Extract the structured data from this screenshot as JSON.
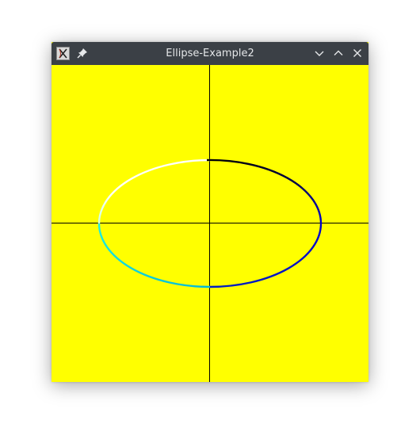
{
  "window": {
    "title": "Ellipse-Example2"
  },
  "icons": {
    "app": "app-icon",
    "pin": "pin-icon",
    "minimize": "chevron-down-icon",
    "maximize": "chevron-up-icon",
    "close": "close-icon"
  },
  "colors": {
    "background": "#ffff00",
    "axes": "#000000",
    "titlebar": "#3b4046",
    "arc_colors": [
      "#ffffff",
      "#000000",
      "#0000cc",
      "#00e6e6"
    ]
  }
}
